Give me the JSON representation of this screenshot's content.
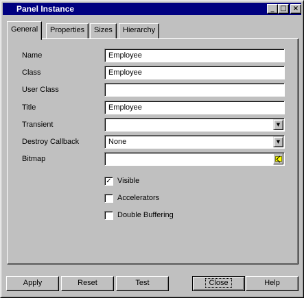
{
  "window": {
    "title": "Panel Instance",
    "controls": {
      "minimize": "_",
      "maximize": "□",
      "close": "×"
    }
  },
  "tabs": [
    {
      "label": "General",
      "active": true
    },
    {
      "label": "Properties",
      "active": false
    },
    {
      "label": "Sizes",
      "active": false
    },
    {
      "label": "Hierarchy",
      "active": false
    }
  ],
  "form": {
    "name": {
      "label": "Name",
      "value": "Employee"
    },
    "class": {
      "label": "Class",
      "value": "Employee"
    },
    "user_class": {
      "label": "User Class",
      "value": ""
    },
    "title": {
      "label": "Title",
      "value": "Employee"
    },
    "transient": {
      "label": "Transient",
      "value": ""
    },
    "destroy_callback": {
      "label": "Destroy Callback",
      "value": "None"
    },
    "bitmap": {
      "label": "Bitmap",
      "value": ""
    }
  },
  "checkboxes": {
    "visible": {
      "label": "Visible",
      "checked": true,
      "mark": "✓"
    },
    "accelerators": {
      "label": "Accelerators",
      "checked": false,
      "mark": ""
    },
    "double_buffering": {
      "label": "Double Buffering",
      "checked": false,
      "mark": ""
    }
  },
  "buttons": {
    "apply": "Apply",
    "reset": "Reset",
    "test": "Test",
    "close": "Close",
    "help": "Help"
  },
  "icons": {
    "dropdown": "▼",
    "browse": "folder-arrow-icon"
  }
}
